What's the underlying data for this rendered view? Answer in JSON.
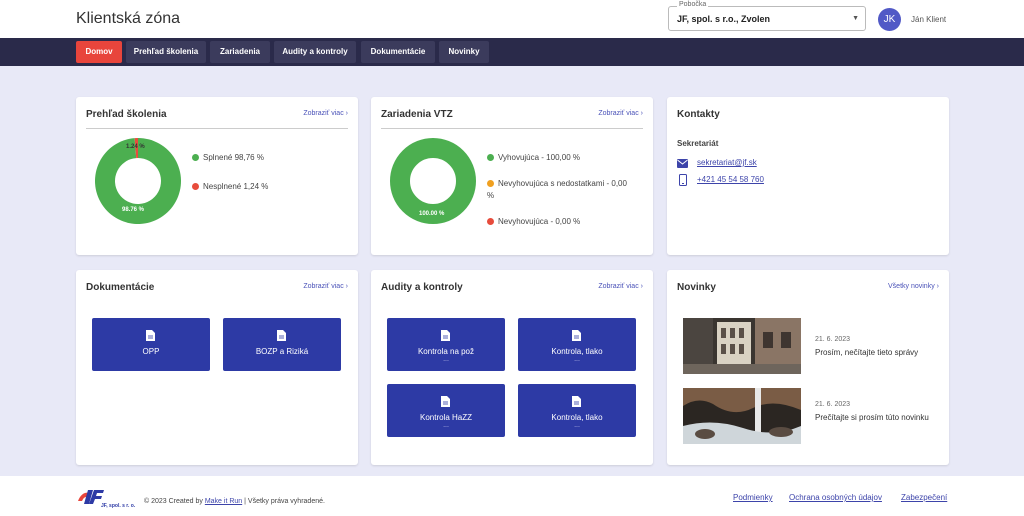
{
  "header": {
    "title": "Klientská zóna",
    "branch_label": "Pobočka",
    "branch_value": "JF, spol. s r.o., Zvolen",
    "avatar_initials": "JK",
    "user_name": "Ján Klient"
  },
  "nav": {
    "items": [
      "Domov",
      "Prehľad školenia",
      "Zariadenia",
      "Audity a kontroly",
      "Dokumentácie",
      "Novinky"
    ],
    "active_color": "#e8453c"
  },
  "training": {
    "title": "Prehľad školenia",
    "link": "Zobraziť viac",
    "legend": [
      "Splnené 98,76 %",
      "Nesplnené 1,24 %"
    ],
    "slice_labels": [
      "98.76 %",
      "1.24 %"
    ],
    "chart_data": {
      "type": "pie",
      "categories": [
        "Splnené",
        "Nesplnené"
      ],
      "values": [
        98.76,
        1.24
      ],
      "colors": [
        "#4caf50",
        "#e74c3c"
      ]
    }
  },
  "devices": {
    "title": "Zariadenia VTZ",
    "link": "Zobraziť viac",
    "legend": [
      "Vyhovujúca - 100,00 %",
      "Nevyhovujúca s nedostatkami - 0,00 %",
      "Nevyhovujúca - 0,00 %"
    ],
    "slice_labels": [
      "100.00 %"
    ],
    "chart_data": {
      "type": "pie",
      "categories": [
        "Vyhovujúca",
        "Nevyhovujúca s nedostatkami",
        "Nevyhovujúca"
      ],
      "values": [
        100.0,
        0.0,
        0.0
      ],
      "colors": [
        "#4caf50",
        "#f0a020",
        "#e74c3c"
      ]
    }
  },
  "contacts": {
    "title": "Kontakty",
    "label": "Sekretariát",
    "email": "sekretariat@jf.sk",
    "phone": "+421 45 54 58 760"
  },
  "docs": {
    "title": "Dokumentácie",
    "link": "Zobraziť viac",
    "items": [
      "OPP",
      "BOZP a Riziká"
    ]
  },
  "audits": {
    "title": "Audity a kontroly",
    "link": "Zobraziť viac",
    "items": [
      {
        "label": "Kontrola na pož",
        "extra": "..."
      },
      {
        "label": "Kontrola, tlako",
        "extra": "..."
      },
      {
        "label": "Kontrola HaZZ",
        "extra": "..."
      },
      {
        "label": "Kontrola, tlako",
        "extra": "..."
      }
    ]
  },
  "news": {
    "title": "Novinky",
    "link": "Všetky novinky",
    "items": [
      {
        "date": "21. 6. 2023",
        "title": "Prosím, nečítajte tieto správy"
      },
      {
        "date": "21. 6. 2023",
        "title": "Prečítajte si prosím túto novinku"
      }
    ]
  },
  "footer": {
    "logo_text": "JF, spol. s r. o.",
    "copy_prefix": "© 2023 Created by",
    "copy_link": "Make it Run",
    "copy_suffix": "| Všetky práva vyhradené.",
    "links": [
      "Podmienky",
      "Ochrana osobných údajov",
      "Zabezpečení"
    ]
  },
  "colors": {
    "brand_blue": "#2d3aa5",
    "nav_bg": "#2a2a4a",
    "page_bg": "#e8e9f7",
    "green": "#4caf50",
    "red": "#e74c3c",
    "orange": "#f0a020"
  }
}
